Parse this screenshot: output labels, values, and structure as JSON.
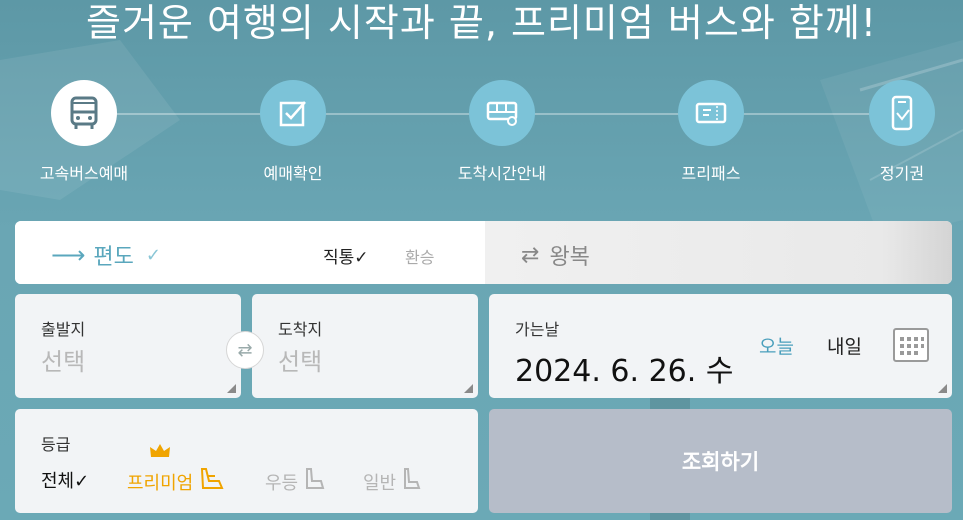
{
  "hero": {
    "title": "즐거운 여행의 시작과 끝, 프리미엄 버스와 함께!"
  },
  "menu": [
    {
      "label": "고속버스예매",
      "icon": "bus-icon",
      "active": true
    },
    {
      "label": "예매확인",
      "icon": "checkbox-icon",
      "active": false
    },
    {
      "label": "도착시간안내",
      "icon": "bus-side-icon",
      "active": false
    },
    {
      "label": "프리패스",
      "icon": "ticket-icon",
      "active": false
    },
    {
      "label": "정기권",
      "icon": "pass-card-icon",
      "active": false
    }
  ],
  "trip": {
    "oneway": "편도",
    "oneway_check": "✓",
    "direct": "직통✓",
    "transfer": "환승",
    "round": "왕복"
  },
  "departure": {
    "label": "출발지",
    "value": "선택"
  },
  "arrival": {
    "label": "도착지",
    "value": "선택"
  },
  "date": {
    "label": "가는날",
    "value": "2024. 6. 26. 수",
    "today": "오늘",
    "tomorrow": "내일"
  },
  "grade": {
    "label": "등급",
    "options": [
      {
        "label": "전체✓",
        "selected": true
      },
      {
        "label": "프리미엄",
        "selected": false
      },
      {
        "label": "우등",
        "selected": false
      },
      {
        "label": "일반",
        "selected": false
      }
    ]
  },
  "search": {
    "label": "조회하기"
  },
  "colors": {
    "accent": "#5aa7bd",
    "premium": "#f0a400",
    "search_bg": "#b6bdc9"
  }
}
